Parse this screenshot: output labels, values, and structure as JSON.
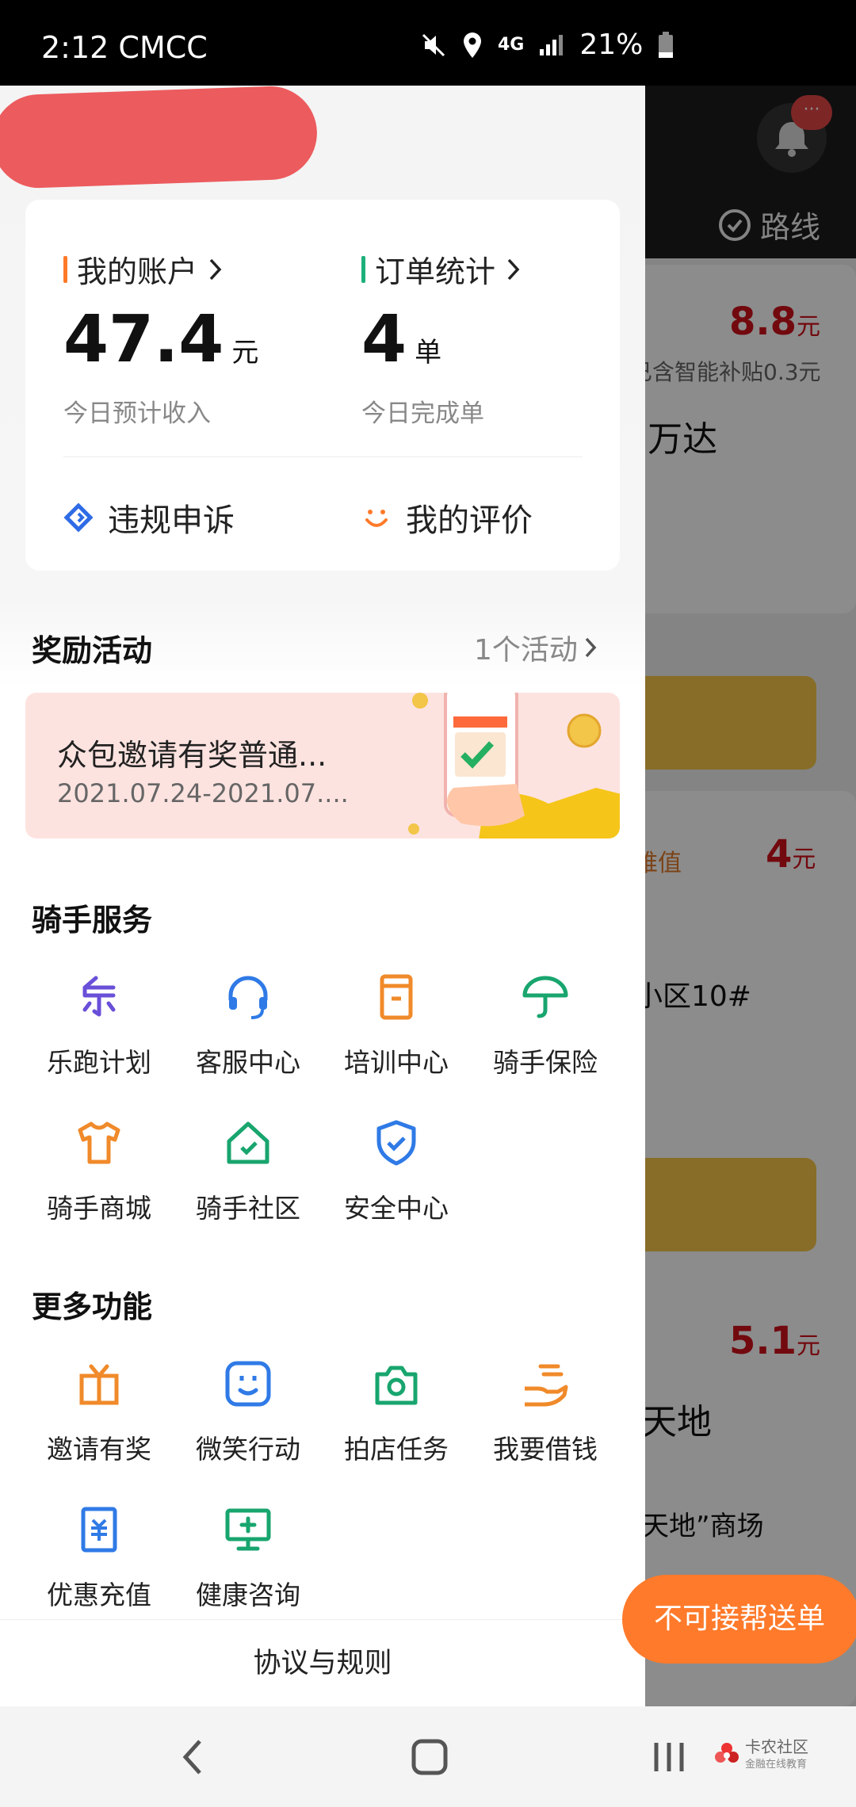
{
  "status_bar": {
    "time_carrier": "2:12 CMCC",
    "network": "4G",
    "battery": "21%"
  },
  "background": {
    "route_label": "路线",
    "order1": {
      "price": "8.8",
      "unit": "元",
      "subsidy": "已含智能补贴0.3元",
      "title": "(万达"
    },
    "order2": {
      "price": "4",
      "unit": "元",
      "tag": "难值",
      "address": "小区10#"
    },
    "order3": {
      "price": "5.1",
      "unit": "元",
      "title": "天地",
      "address": "天地”商场"
    },
    "fab_label": "不可接帮送单",
    "notification_badge": "···"
  },
  "drawer": {
    "account": {
      "title": "我的账户",
      "value": "47.4",
      "unit": "元",
      "desc": "今日预计收入",
      "accent": "#ff7a2a"
    },
    "orders": {
      "title": "订单统计",
      "value": "4",
      "unit": "单",
      "desc": "今日完成单",
      "accent": "#1db07a"
    },
    "quick_actions": [
      {
        "label": "违规申诉",
        "icon": "appeal-icon"
      },
      {
        "label": "我的评价",
        "icon": "smile-icon"
      }
    ],
    "rewards": {
      "title": "奖励活动",
      "count": "1个活动",
      "banner_title": "众包邀请有奖普通...",
      "banner_date": "2021.07.24-2021.07...."
    },
    "rider_services": {
      "title": "骑手服务",
      "items": [
        {
          "label": "乐跑计划",
          "icon": "le-run-icon"
        },
        {
          "label": "客服中心",
          "icon": "headset-icon"
        },
        {
          "label": "培训中心",
          "icon": "book-icon"
        },
        {
          "label": "骑手保险",
          "icon": "umbrella-icon"
        },
        {
          "label": "骑手商城",
          "icon": "tshirt-icon"
        },
        {
          "label": "骑手社区",
          "icon": "house-icon"
        },
        {
          "label": "安全中心",
          "icon": "shield-icon"
        }
      ]
    },
    "more_features": {
      "title": "更多功能",
      "items": [
        {
          "label": "邀请有奖",
          "icon": "gift-icon"
        },
        {
          "label": "微笑行动",
          "icon": "face-icon"
        },
        {
          "label": "拍店任务",
          "icon": "camera-icon"
        },
        {
          "label": "我要借钱",
          "icon": "hand-money-icon"
        },
        {
          "label": "优惠充值",
          "icon": "recharge-icon"
        },
        {
          "label": "健康咨询",
          "icon": "health-icon"
        }
      ]
    },
    "footer_label": "协议与规则"
  },
  "nav_bar": {
    "watermark_title": "卡农社区",
    "watermark_sub": "金融在线教育"
  }
}
